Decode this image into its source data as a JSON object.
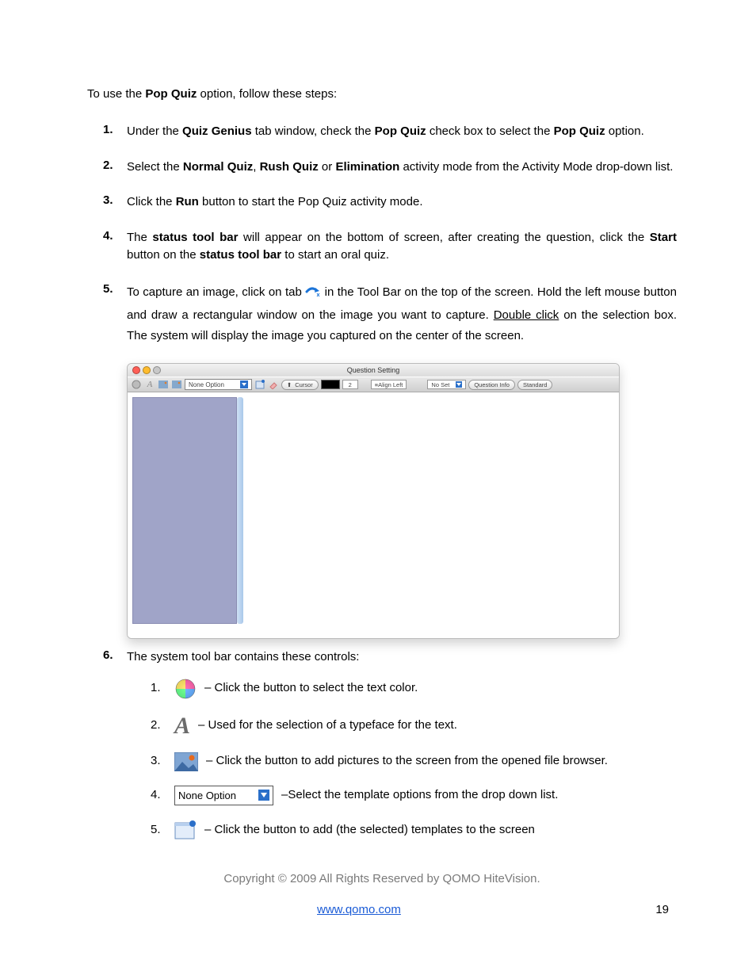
{
  "intro": {
    "pre": "To use the ",
    "bold": "Pop Quiz",
    "post": " option, follow these steps:"
  },
  "steps": [
    {
      "num": "1.",
      "segments": [
        {
          "t": "Under the "
        },
        {
          "t": "Quiz Genius",
          "b": true
        },
        {
          "t": " tab window, check the "
        },
        {
          "t": "Pop Quiz",
          "b": true
        },
        {
          "t": " check box to select the "
        },
        {
          "t": "Pop Quiz",
          "b": true
        },
        {
          "t": " option."
        }
      ]
    },
    {
      "num": "2.",
      "segments": [
        {
          "t": "Select the "
        },
        {
          "t": "Normal Quiz",
          "b": true
        },
        {
          "t": ", "
        },
        {
          "t": "Rush Quiz",
          "b": true
        },
        {
          "t": " or "
        },
        {
          "t": "Elimination",
          "b": true
        },
        {
          "t": " activity mode from the Activity Mode drop-down list."
        }
      ]
    },
    {
      "num": "3.",
      "segments": [
        {
          "t": "Click the "
        },
        {
          "t": "Run",
          "b": true
        },
        {
          "t": " button to start the Pop Quiz activity mode."
        }
      ]
    },
    {
      "num": "4.",
      "segments": [
        {
          "t": "The "
        },
        {
          "t": "status tool bar",
          "b": true
        },
        {
          "t": " will appear on the bottom of screen, after creating the question, click the "
        },
        {
          "t": "Start",
          "b": true
        },
        {
          "t": " button on the "
        },
        {
          "t": "status tool bar",
          "b": true
        },
        {
          "t": " to start an oral quiz."
        }
      ]
    },
    {
      "num": "5.",
      "pre_icon": "To capture an image, click on tab",
      "post_icon_segments": [
        {
          "t": "in the Tool Bar on the top of the screen. Hold the left mouse button and draw a rectangular window on the image you want to capture. "
        },
        {
          "t": "Double click",
          "u": true
        },
        {
          "t": " on the selection box. The system will display the image you captured on the center of the screen."
        }
      ]
    },
    {
      "num": "6.",
      "lead": "The system tool bar contains these controls:"
    }
  ],
  "app": {
    "title": "Question Setting",
    "toolbar": {
      "none_option": "None Option",
      "cursor": "Cursor",
      "num": "2",
      "align": "Align Left",
      "no_set": "No Set",
      "qinfo": "Question Info",
      "standard": "Standard"
    }
  },
  "sublist": [
    {
      "n": "1.",
      "text": " – Click the button to select the text color."
    },
    {
      "n": "2.",
      "text": " – Used for the selection of a typeface for the text."
    },
    {
      "n": "3.",
      "text": " – Click the button to add pictures to the screen from the opened file browser."
    },
    {
      "n": "4.",
      "label": "None Option",
      "text": " –Select the template options from the drop down list."
    },
    {
      "n": "5.",
      "text": " – Click the button to add (the selected) templates to the screen"
    }
  ],
  "copyright": "Copyright © 2009 All Rights Reserved by QOMO HiteVision.",
  "footer": {
    "url": "www.qomo.com",
    "page": "19"
  }
}
